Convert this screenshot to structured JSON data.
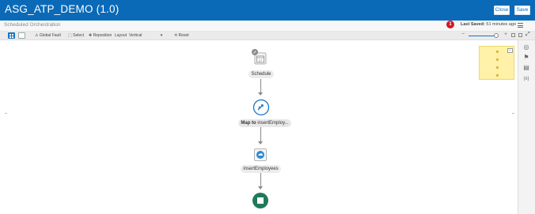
{
  "header": {
    "title": "ASG_ATP_DEMO (1.0)",
    "close_label": "Close",
    "save_label": "Save"
  },
  "subheader": {
    "title": "Scheduled Orchestration",
    "error_count": "1",
    "last_saved_label": "Last Saved:",
    "last_saved_value": "51 minutes ago"
  },
  "toolbar": {
    "global_fault": "Global Fault",
    "select": "Select",
    "reposition": "Reposition",
    "layout_label": "Layout",
    "layout_value": "Vertical",
    "reset": "Reset",
    "zoom_minus": "−",
    "zoom_plus": "+"
  },
  "flow": {
    "nodes": [
      {
        "label": "Schedule",
        "icon": "calendar-icon"
      },
      {
        "label_bold": "Map to",
        "label_rest": " insertEmploy...",
        "icon": "map-icon"
      },
      {
        "label": "insertEmployees",
        "icon": "cloud-adapter-icon"
      },
      {
        "label": "",
        "icon": "stop-icon"
      }
    ]
  },
  "rail": {
    "icons": [
      "target-icon",
      "flag-icon",
      "document-icon",
      "expression-icon"
    ],
    "expression_text": "(x)"
  },
  "colors": {
    "title_bar": "#0a6ab8",
    "accent": "#1a74c4",
    "error": "#d4171d",
    "end_node": "#1f7a5c",
    "minimap": "#fff2a8"
  }
}
